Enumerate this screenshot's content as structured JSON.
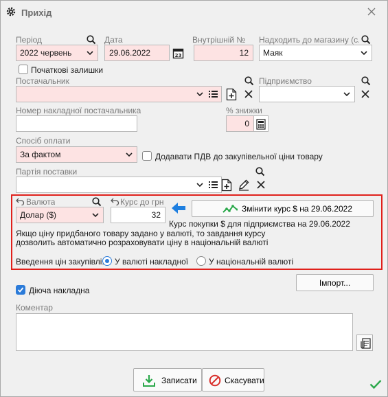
{
  "window": {
    "title": "Прихід"
  },
  "form": {
    "period": {
      "label": "Період",
      "value": "2022 червень"
    },
    "date": {
      "label": "Дата",
      "value": "29.06.2022"
    },
    "internal_no": {
      "label": "Внутрішній №",
      "value": "12"
    },
    "store": {
      "label": "Надходить до магазину (с...",
      "value": "Маяк"
    },
    "initial_balances": {
      "label": "Початкові залишки",
      "checked": false
    },
    "supplier": {
      "label": "Постачальник",
      "value": ""
    },
    "enterprise": {
      "label": "Підприємство",
      "value": ""
    },
    "supplier_invoice": {
      "label": "Номер накладної постачальника",
      "value": ""
    },
    "discount": {
      "label": "% знижки",
      "value": "0"
    },
    "payment_method": {
      "label": "Спосіб оплати",
      "value": "За фактом"
    },
    "vat": {
      "label": "Додавати ПДВ до закупівельної ціни товару",
      "checked": false
    },
    "batch": {
      "label": "Партія поставки",
      "value": ""
    },
    "currency": {
      "label": "Валюта",
      "value": "Долар ($)"
    },
    "rate": {
      "label": "Курс до грн",
      "value": "32"
    },
    "change_rate_button": "Змінити курс $ на 29.06.2022",
    "rate_caption": "Курс покупки $ для підприємства на 29.06.2022",
    "info_text": "Якщо ціну придбаного товару задано у валюті, то завдання курсу дозволить автоматично розраховувати ціну в національній валюті",
    "price_entry": {
      "label": "Введення цін закупівлі:",
      "option_invoice": "У валюті накладної",
      "option_national": "У національній валюті",
      "selected": "invoice"
    },
    "import_button": "Імпорт...",
    "active_invoice": {
      "label": "Діюча накладна",
      "checked": true
    },
    "comment": {
      "label": "Коментар",
      "value": ""
    },
    "save_button": "Записати",
    "cancel_button": "Скасувати"
  },
  "colors": {
    "required_bg": "#fde3e3",
    "accent_blue": "#2b7bd9",
    "highlight_red": "#e0201b",
    "chart_green": "#2aa84a",
    "cancel_red": "#d9302c"
  }
}
